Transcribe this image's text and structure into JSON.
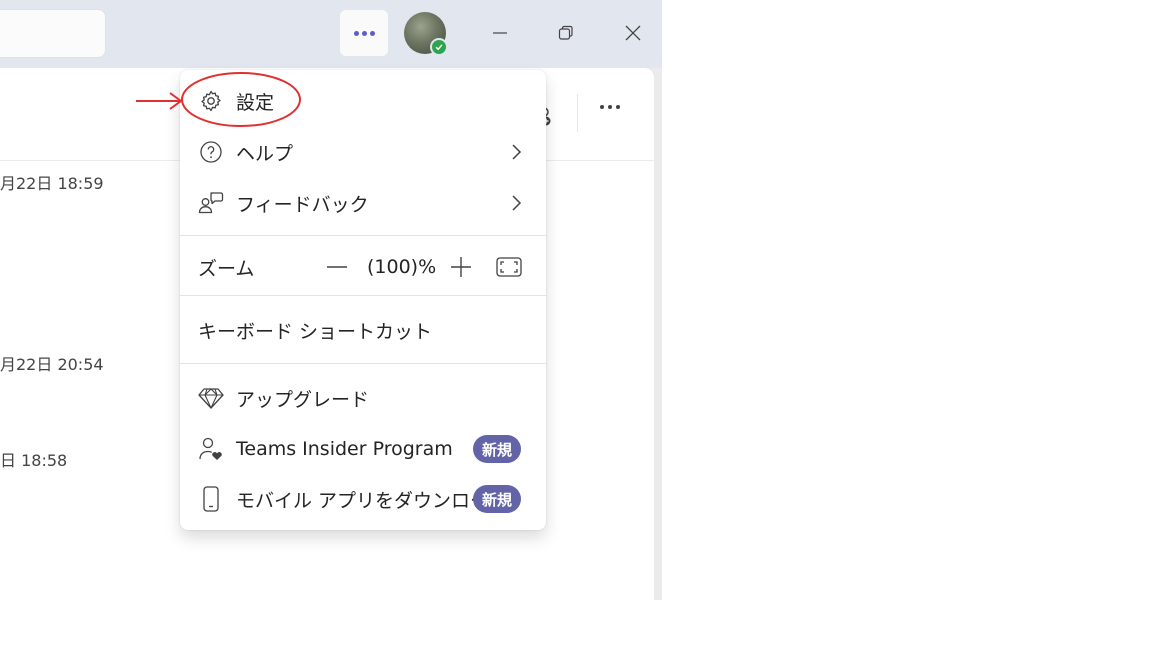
{
  "titlebar": {
    "more_options_icon": "more-horizontal-icon",
    "user_status": "available",
    "window_controls": [
      "minimize",
      "restore",
      "close"
    ]
  },
  "chat": {
    "timestamps": [
      "月22日 18:59",
      "月22日 20:54",
      "日 18:58"
    ]
  },
  "menu": {
    "settings_label": "設定",
    "help_label": "ヘルプ",
    "feedback_label": "フィードバック",
    "zoom": {
      "label": "ズーム",
      "value": "(100)%"
    },
    "shortcuts_label": "キーボード ショートカット",
    "upgrade_label": "アップグレード",
    "insider_label": "Teams Insider Program",
    "insider_badge": "新規",
    "mobile_label": "モバイル アプリをダウンロード",
    "mobile_badge": "新規"
  },
  "colors": {
    "accent": "#5b5fc7",
    "badge": "#6264a7",
    "presence": "#2ea44f",
    "annotation": "#e03030",
    "titlebar": "#e2e6ee"
  }
}
